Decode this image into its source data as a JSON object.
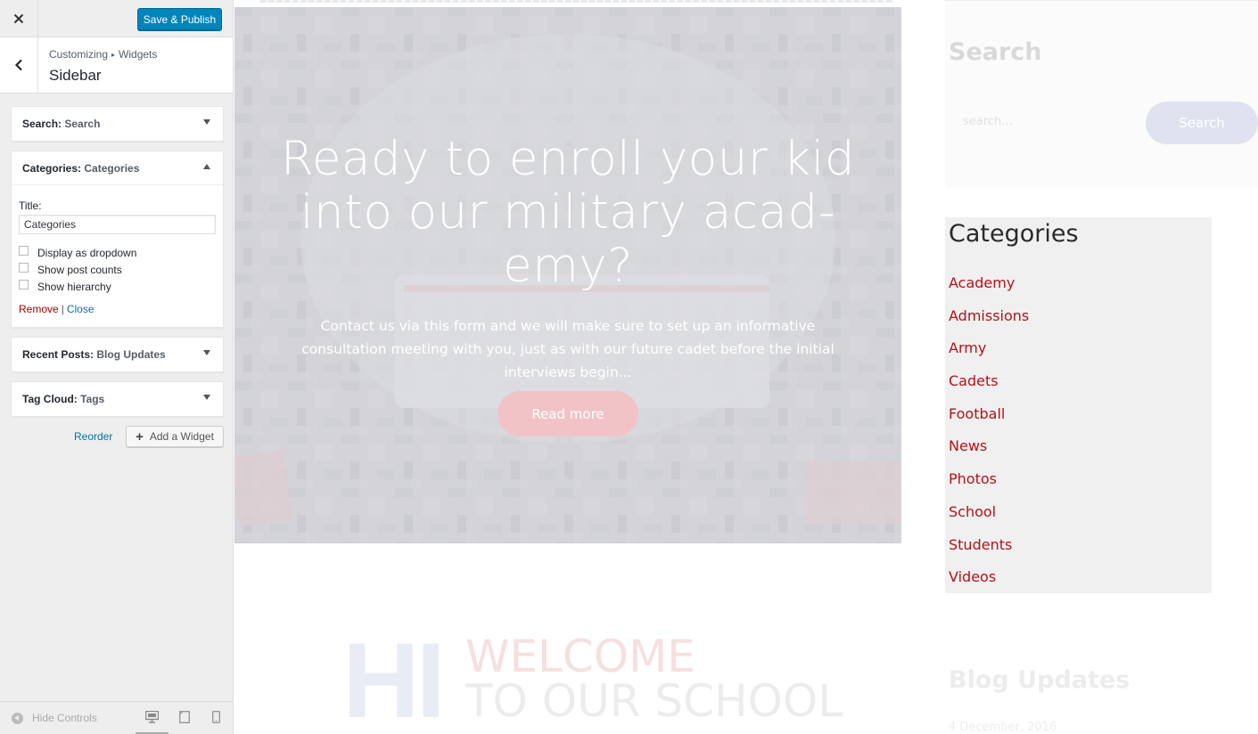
{
  "header": {
    "close_icon": "close-icon",
    "save_label": "Save & Publish",
    "save_color": "#0085ba"
  },
  "section": {
    "breadcrumb_root": "Customizing",
    "breadcrumb_child": "Widgets",
    "title": "Sidebar"
  },
  "widgets": [
    {
      "type": "Search:",
      "name": "Search",
      "expanded": false
    },
    {
      "type": "Categories:",
      "name": "Categories",
      "expanded": true
    },
    {
      "type": "Recent Posts:",
      "name": "Blog Updates",
      "expanded": false
    },
    {
      "type": "Tag Cloud:",
      "name": "Tags",
      "expanded": false
    }
  ],
  "categories_form": {
    "title_label": "Title:",
    "title_value": "Categories",
    "checkboxes": [
      {
        "label": "Display as dropdown",
        "checked": false
      },
      {
        "label": "Show post counts",
        "checked": false
      },
      {
        "label": "Show hierarchy",
        "checked": false
      }
    ],
    "remove_label": "Remove",
    "separator": "|",
    "close_label": "Close"
  },
  "panel_actions": {
    "reorder_label": "Reorder",
    "add_widget_label": "Add a Widget"
  },
  "footer": {
    "hide_controls_label": "Hide Controls"
  },
  "preview": {
    "hero": {
      "title": "Ready to enroll your kid into our military acad-emy?",
      "text": "Contact us via this form and we will make sure to set up an informative consultation meeting with you, just as with our future cadet before the initial interviews begin...",
      "button_label": "Read more"
    },
    "search_widget": {
      "heading": "Search",
      "placeholder": "search...",
      "button_label": "Search"
    },
    "categories_widget": {
      "heading": "Categories",
      "items": [
        "Academy",
        "Admissions",
        "Army",
        "Cadets",
        "Football",
        "News",
        "Photos",
        "School",
        "Students",
        "Videos"
      ],
      "link_color": "#b5121b"
    },
    "welcome": {
      "big_letters": "HI",
      "line1": "WELCOME",
      "line2": "TO OUR SCHOOL"
    },
    "blog": {
      "heading": "Blog Updates",
      "date": "4 December, 2016"
    }
  }
}
